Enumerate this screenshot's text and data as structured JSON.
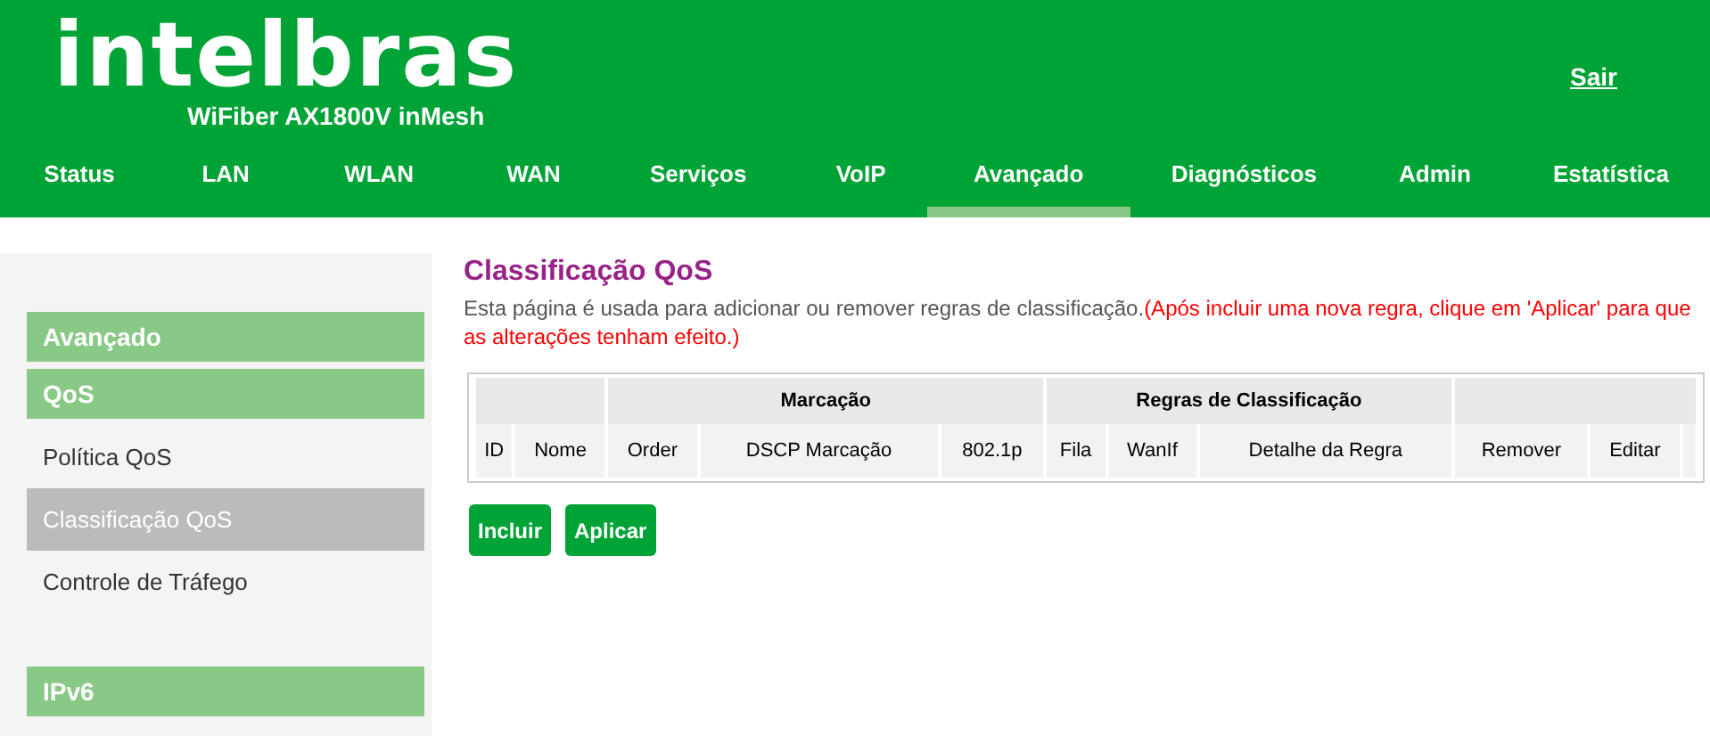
{
  "header": {
    "logo": "intelbras",
    "model": "WiFiber AX1800V inMesh",
    "logout": "Sair"
  },
  "tabs": [
    {
      "label": "Status",
      "selected": false
    },
    {
      "label": "LAN",
      "selected": false
    },
    {
      "label": "WLAN",
      "selected": false
    },
    {
      "label": "WAN",
      "selected": false
    },
    {
      "label": "Serviços",
      "selected": false
    },
    {
      "label": "VoIP",
      "selected": false
    },
    {
      "label": "Avançado",
      "selected": true
    },
    {
      "label": "Diagnósticos",
      "selected": false
    },
    {
      "label": "Admin",
      "selected": false
    },
    {
      "label": "Estatística",
      "selected": false
    }
  ],
  "sidebar": {
    "items": [
      {
        "kind": "section",
        "label": "Avançado"
      },
      {
        "kind": "section",
        "label": "QoS"
      },
      {
        "kind": "link",
        "label": "Política QoS",
        "selected": false
      },
      {
        "kind": "link",
        "label": "Classificação QoS",
        "selected": true
      },
      {
        "kind": "link",
        "label": "Controle de Tráfego",
        "selected": false
      },
      {
        "kind": "spacer"
      },
      {
        "kind": "section",
        "label": "IPv6"
      }
    ]
  },
  "page": {
    "title": "Classificação QoS",
    "description": "Esta página é usada para adicionar ou remover regras de classificação.",
    "warning": "(Após incluir uma nova regra, clique em 'Aplicar' para que as alterações tenham efeito.)"
  },
  "table": {
    "groups": [
      "Marcação",
      "Regras de Classificação"
    ],
    "columns": [
      "ID",
      "Nome",
      "Order",
      "DSCP Marcação",
      "802.1p",
      "Fila",
      "WanIf",
      "Detalhe da Regra",
      "Remover",
      "Editar"
    ]
  },
  "buttons": [
    "Incluir",
    "Aplicar"
  ]
}
